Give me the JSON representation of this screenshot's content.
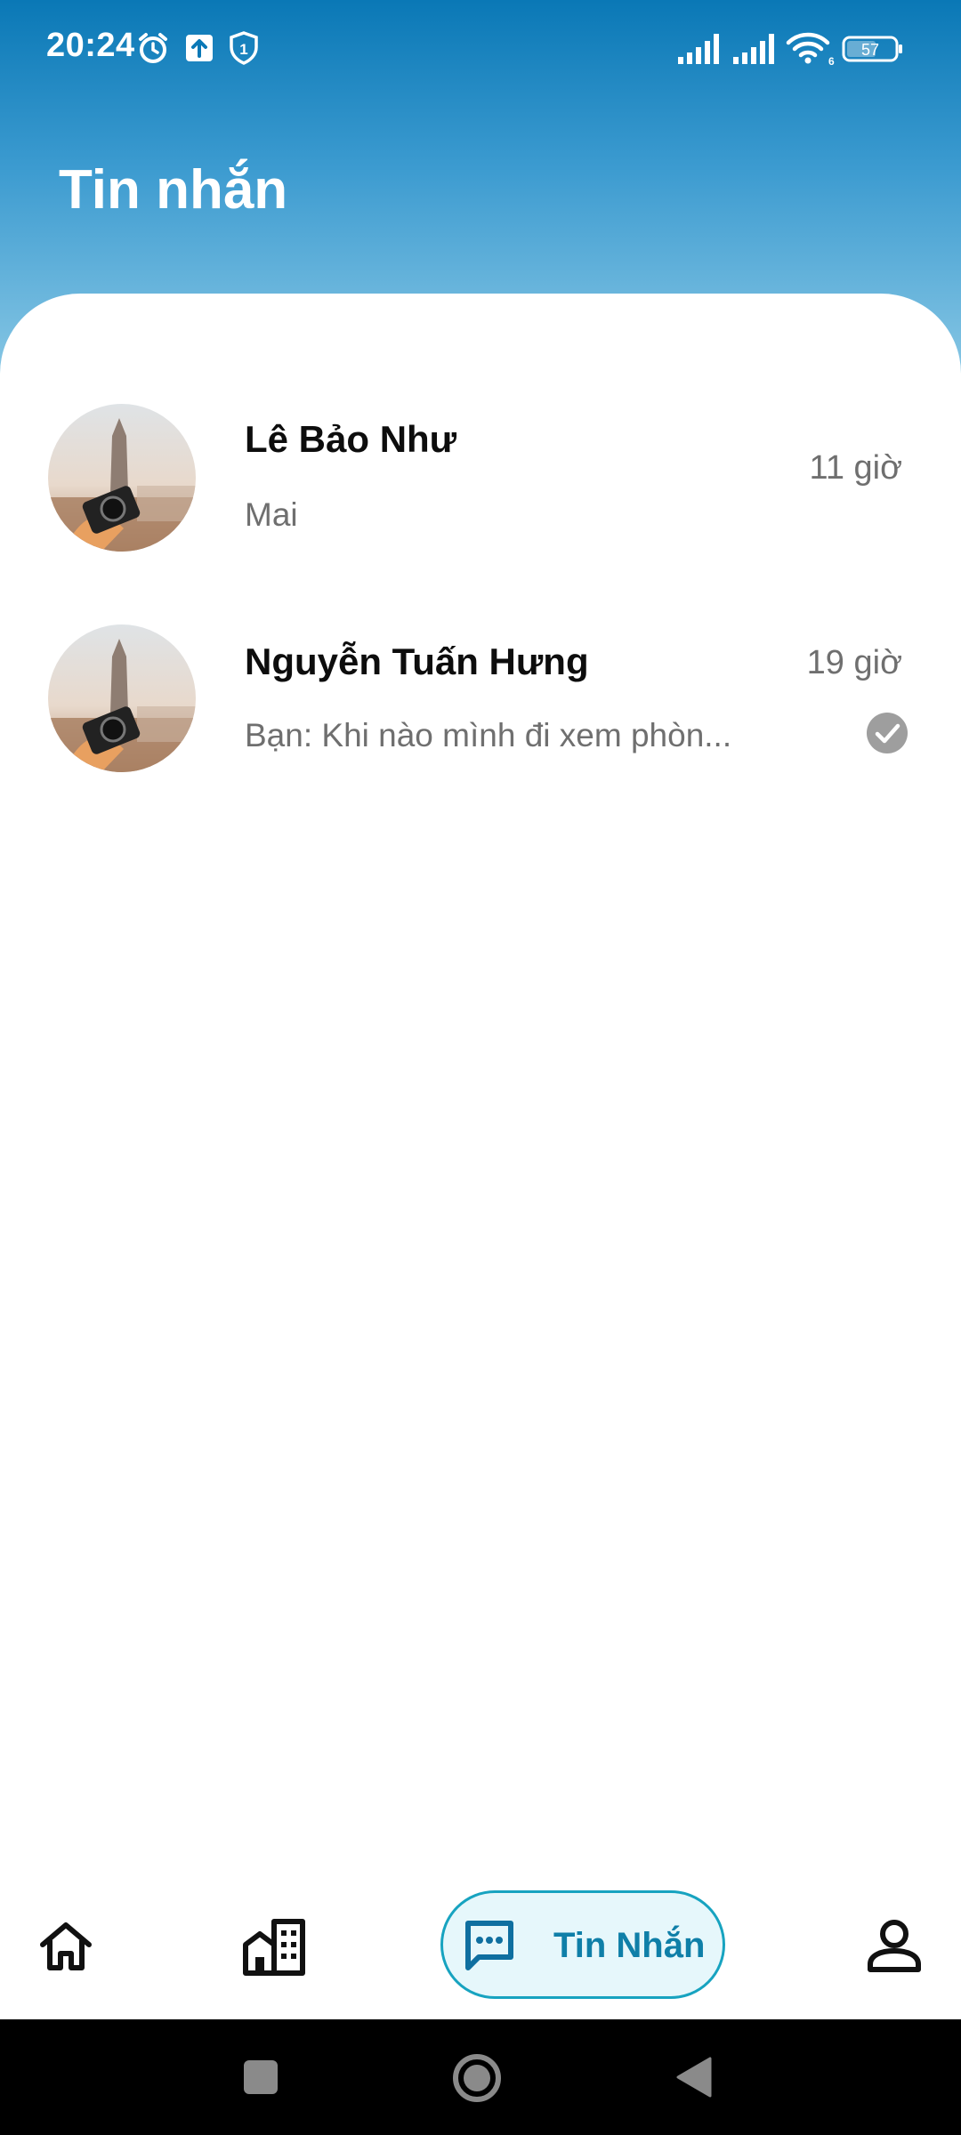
{
  "status_bar": {
    "time": "20:24",
    "left_icons": [
      "alarm-icon",
      "upload-icon",
      "shield-icon"
    ],
    "shield_number": "1",
    "right_icons": [
      "signal-icon",
      "signal-icon",
      "wifi-icon",
      "battery-icon"
    ],
    "wifi_label": "6",
    "battery_level": "57"
  },
  "header": {
    "title": "Tin nhắn"
  },
  "conversations": [
    {
      "name": "Lê Bảo Như",
      "last_message": "Mai",
      "time": "11 giờ",
      "read": false
    },
    {
      "name": "Nguyễn Tuấn Hưng",
      "last_message": "Bạn: Khi nào mình đi xem phòn...",
      "time": "19 giờ",
      "read": true
    }
  ],
  "bottom_nav": {
    "items": [
      {
        "icon": "home-icon"
      },
      {
        "icon": "buildings-icon"
      },
      {
        "icon": "chat-icon",
        "label": "Tin Nhắn",
        "active": true
      },
      {
        "icon": "person-icon"
      }
    ]
  },
  "colors": {
    "header_top": "#0a78b6",
    "header_bottom": "#86c6e4",
    "accent": "#17a3c0",
    "active_bg": "#e6f7fb"
  }
}
